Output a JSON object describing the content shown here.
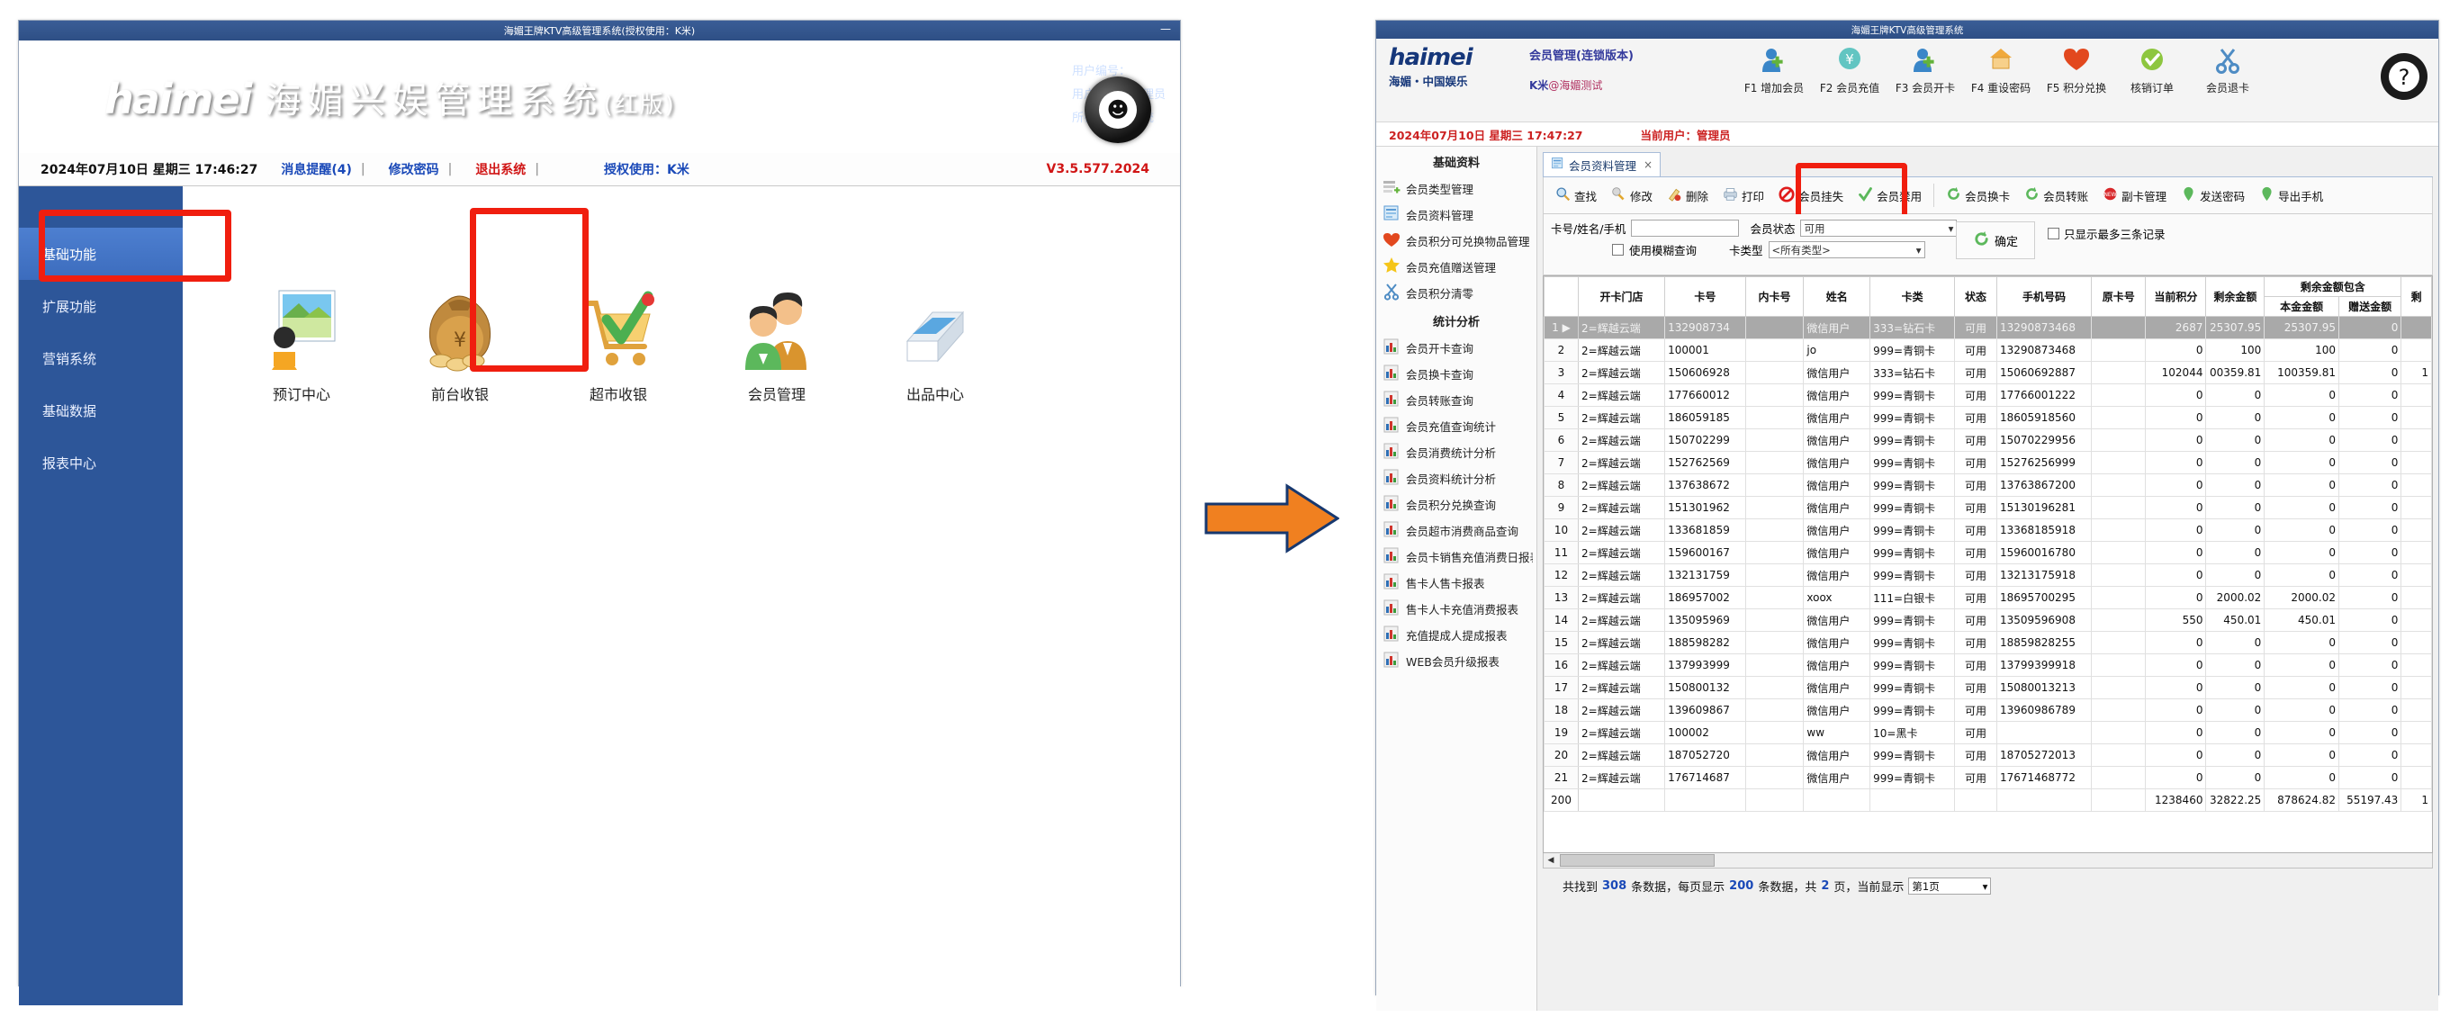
{
  "left_window": {
    "titlebar": {
      "title": "海媚王牌KTV高级管理系统(授权使用：K米)",
      "minimize": "—"
    },
    "banner": {
      "logo_mark": "haimei",
      "logo_title": "海媚兴娱管理系统",
      "logo_title_suffix": "(红版)",
      "user_no_label": "用户编号：",
      "user_name_label": "用户姓名：",
      "user_name_value": "管理员",
      "dept_label": "所在部门：",
      "dept_value": "系统"
    },
    "infobar": {
      "datetime": "2024年07月10日 星期三 17:46:27",
      "msg_link": "消息提醒(4)",
      "pwd_link": "修改密码",
      "exit_link": "退出系统",
      "sep": "|",
      "auth": "授权使用：K米",
      "version": "V3.5.577.2024"
    },
    "sidebar": [
      {
        "label": "基础功能",
        "active": true
      },
      {
        "label": "扩展功能",
        "active": false
      },
      {
        "label": "营销系统",
        "active": false
      },
      {
        "label": "基础数据",
        "active": false
      },
      {
        "label": "报表中心",
        "active": false
      }
    ],
    "apps": [
      {
        "label": "预订中心",
        "icon": "booking-icon"
      },
      {
        "label": "前台收银",
        "icon": "cashier-icon"
      },
      {
        "label": "超市收银",
        "icon": "market-cashier-icon"
      },
      {
        "label": "会员管理",
        "icon": "member-管理-icon",
        "highlighted": true
      },
      {
        "label": "出品中心",
        "icon": "kitchen-icon"
      }
    ],
    "highlight_color": "#f01e0f"
  },
  "arrow": {
    "color": "#f08020",
    "stroke": "#17386f"
  },
  "right_window": {
    "titlebar": {
      "title": "海媚王牌KTV高级管理系统"
    },
    "head": {
      "logo_mark": "haimei",
      "logo_sub": "海媚・中国娱乐",
      "title": "会员管理(连锁版本)",
      "subtitle_prefix": "K米",
      "subtitle": "@海媚测试"
    },
    "toolbar": [
      {
        "label": "F1 增加会员",
        "icon": "add-member-icon"
      },
      {
        "label": "F2 会员充值",
        "icon": "recharge-yen-icon"
      },
      {
        "label": "F3 会员开卡",
        "icon": "open-card-icon"
      },
      {
        "label": "F4 重设密码",
        "icon": "reset-password-icon"
      },
      {
        "label": "F5 积分兑换",
        "icon": "points-exchange-heart-icon"
      },
      {
        "label": "核销订单",
        "icon": "verify-order-check-icon"
      },
      {
        "label": "会员退卡",
        "icon": "return-card-scissors-icon"
      }
    ],
    "help_icon": "help-question-icon",
    "infobar": {
      "datetime": "2024年07月10日 星期三 17:47:27",
      "current_user": "当前用户：管理员"
    },
    "sidebar": {
      "group1_title": "基础资料",
      "group1": [
        {
          "label": "会员类型管理",
          "icon": "list-add-icon"
        },
        {
          "label": "会员资料管理",
          "icon": "document-blue-icon"
        },
        {
          "label": "会员积分可兑换物品管理",
          "icon": "heart-red-icon"
        },
        {
          "label": "会员充值赠送管理",
          "icon": "star-yellow-icon"
        },
        {
          "label": "会员积分清零",
          "icon": "scissors-icon"
        }
      ],
      "group2_title": "统计分析",
      "group2": [
        {
          "label": "会员开卡查询",
          "icon": "report-chart-icon"
        },
        {
          "label": "会员换卡查询",
          "icon": "report-chart-icon"
        },
        {
          "label": "会员转账查询",
          "icon": "report-chart-icon"
        },
        {
          "label": "会员充值查询统计",
          "icon": "report-chart-icon"
        },
        {
          "label": "会员消费统计分析",
          "icon": "report-chart-icon"
        },
        {
          "label": "会员资料统计分析",
          "icon": "report-chart-icon"
        },
        {
          "label": "会员积分兑换查询",
          "icon": "report-chart-icon"
        },
        {
          "label": "会员超市消费商品查询",
          "icon": "report-chart-icon"
        },
        {
          "label": "会员卡销售充值消费日报表",
          "icon": "report-chart-icon"
        },
        {
          "label": "售卡人售卡报表",
          "icon": "report-chart-icon"
        },
        {
          "label": "售卡人卡充值消费报表",
          "icon": "report-chart-icon"
        },
        {
          "label": "充值提成人提成报表",
          "icon": "report-chart-icon"
        },
        {
          "label": "WEB会员升级报表",
          "icon": "report-chart-icon"
        }
      ]
    },
    "tab": {
      "label": "会员资料管理",
      "close": "×",
      "icon": "document-blue-icon"
    },
    "actions": [
      {
        "label": "查找",
        "icon": "magnifier-icon",
        "highlighted": false
      },
      {
        "label": "修改",
        "icon": "pencil-edit-icon",
        "highlighted": false
      },
      {
        "label": "删除",
        "icon": "pencil-delete-icon",
        "highlighted": false
      },
      {
        "label": "打印",
        "icon": "printer-icon",
        "highlighted": false
      },
      {
        "label": "会员挂失",
        "icon": "forbidden-icon",
        "highlighted": true
      },
      {
        "label": "会员禁用",
        "icon": "check-green-icon",
        "highlighted": false
      },
      {
        "label": "会员换卡",
        "icon": "refresh-green-icon",
        "highlighted": false
      },
      {
        "label": "会员转账",
        "icon": "refresh-green-icon",
        "highlighted": false
      },
      {
        "label": "副卡管理",
        "icon": "new-badge-icon",
        "highlighted": false
      },
      {
        "label": "发送密码",
        "icon": "pin-green-icon",
        "highlighted": false
      },
      {
        "label": "导出手机",
        "icon": "pin-green-icon",
        "highlighted": false
      }
    ],
    "filter": {
      "keyword_label": "卡号/姓名/手机",
      "keyword_value": "",
      "status_label": "会员状态",
      "status_value": "可用",
      "fuzzy_label": "使用模糊查询",
      "fuzzy_checked": false,
      "cardtype_label": "卡类型",
      "cardtype_value": "<所有类型>",
      "ok_label": "确定",
      "ok_icon": "refresh-green-icon",
      "only3_label": "只显示最多三条记录",
      "only3_checked": false
    },
    "table": {
      "group_header": "剩余金额包含",
      "columns": [
        "开卡门店",
        "卡号",
        "内卡号",
        "姓名",
        "卡类",
        "状态",
        "手机号码",
        "原卡号",
        "当前积分",
        "剩余金额",
        "本金金额",
        "赠送金额",
        "剩"
      ],
      "rows": [
        {
          "idx": "1",
          "marker": "▶",
          "selected": true,
          "cells": [
            "2=辉越云端",
            "132908734",
            "",
            "微信用户",
            "333=钻石卡",
            "可用",
            "13290873468",
            "",
            "2687",
            "25307.95",
            "25307.95",
            "0",
            ""
          ]
        },
        {
          "idx": "2",
          "marker": "",
          "selected": false,
          "cells": [
            "2=辉越云端",
            "100001",
            "",
            "jo",
            "999=青铜卡",
            "可用",
            "13290873468",
            "",
            "0",
            "100",
            "100",
            "0",
            ""
          ]
        },
        {
          "idx": "3",
          "marker": "",
          "selected": false,
          "cells": [
            "2=辉越云端",
            "150606928",
            "",
            "微信用户",
            "333=钻石卡",
            "可用",
            "15060692887",
            "",
            "102044",
            "00359.81",
            "100359.81",
            "0",
            "1"
          ]
        },
        {
          "idx": "4",
          "marker": "",
          "selected": false,
          "cells": [
            "2=辉越云端",
            "177660012",
            "",
            "微信用户",
            "999=青铜卡",
            "可用",
            "17766001222",
            "",
            "0",
            "0",
            "0",
            "0",
            ""
          ]
        },
        {
          "idx": "5",
          "marker": "",
          "selected": false,
          "cells": [
            "2=辉越云端",
            "186059185",
            "",
            "微信用户",
            "999=青铜卡",
            "可用",
            "18605918560",
            "",
            "0",
            "0",
            "0",
            "0",
            ""
          ]
        },
        {
          "idx": "6",
          "marker": "",
          "selected": false,
          "cells": [
            "2=辉越云端",
            "150702299",
            "",
            "微信用户",
            "999=青铜卡",
            "可用",
            "15070229956",
            "",
            "0",
            "0",
            "0",
            "0",
            ""
          ]
        },
        {
          "idx": "7",
          "marker": "",
          "selected": false,
          "cells": [
            "2=辉越云端",
            "152762569",
            "",
            "微信用户",
            "999=青铜卡",
            "可用",
            "15276256999",
            "",
            "0",
            "0",
            "0",
            "0",
            ""
          ]
        },
        {
          "idx": "8",
          "marker": "",
          "selected": false,
          "cells": [
            "2=辉越云端",
            "137638672",
            "",
            "微信用户",
            "999=青铜卡",
            "可用",
            "13763867200",
            "",
            "0",
            "0",
            "0",
            "0",
            ""
          ]
        },
        {
          "idx": "9",
          "marker": "",
          "selected": false,
          "cells": [
            "2=辉越云端",
            "151301962",
            "",
            "微信用户",
            "999=青铜卡",
            "可用",
            "15130196281",
            "",
            "0",
            "0",
            "0",
            "0",
            ""
          ]
        },
        {
          "idx": "10",
          "marker": "",
          "selected": false,
          "cells": [
            "2=辉越云端",
            "133681859",
            "",
            "微信用户",
            "999=青铜卡",
            "可用",
            "13368185918",
            "",
            "0",
            "0",
            "0",
            "0",
            ""
          ]
        },
        {
          "idx": "11",
          "marker": "",
          "selected": false,
          "cells": [
            "2=辉越云端",
            "159600167",
            "",
            "微信用户",
            "999=青铜卡",
            "可用",
            "15960016780",
            "",
            "0",
            "0",
            "0",
            "0",
            ""
          ]
        },
        {
          "idx": "12",
          "marker": "",
          "selected": false,
          "cells": [
            "2=辉越云端",
            "132131759",
            "",
            "微信用户",
            "999=青铜卡",
            "可用",
            "13213175918",
            "",
            "0",
            "0",
            "0",
            "0",
            ""
          ]
        },
        {
          "idx": "13",
          "marker": "",
          "selected": false,
          "cells": [
            "2=辉越云端",
            "186957002",
            "",
            "xoox",
            "111=白银卡",
            "可用",
            "18695700295",
            "",
            "0",
            "2000.02",
            "2000.02",
            "0",
            ""
          ]
        },
        {
          "idx": "14",
          "marker": "",
          "selected": false,
          "cells": [
            "2=辉越云端",
            "135095969",
            "",
            "微信用户",
            "999=青铜卡",
            "可用",
            "13509596908",
            "",
            "550",
            "450.01",
            "450.01",
            "0",
            ""
          ]
        },
        {
          "idx": "15",
          "marker": "",
          "selected": false,
          "cells": [
            "2=辉越云端",
            "188598282",
            "",
            "微信用户",
            "999=青铜卡",
            "可用",
            "18859828255",
            "",
            "0",
            "0",
            "0",
            "0",
            ""
          ]
        },
        {
          "idx": "16",
          "marker": "",
          "selected": false,
          "cells": [
            "2=辉越云端",
            "137993999",
            "",
            "微信用户",
            "999=青铜卡",
            "可用",
            "13799399918",
            "",
            "0",
            "0",
            "0",
            "0",
            ""
          ]
        },
        {
          "idx": "17",
          "marker": "",
          "selected": false,
          "cells": [
            "2=辉越云端",
            "150800132",
            "",
            "微信用户",
            "999=青铜卡",
            "可用",
            "15080013213",
            "",
            "0",
            "0",
            "0",
            "0",
            ""
          ]
        },
        {
          "idx": "18",
          "marker": "",
          "selected": false,
          "cells": [
            "2=辉越云端",
            "139609867",
            "",
            "微信用户",
            "999=青铜卡",
            "可用",
            "13960986789",
            "",
            "0",
            "0",
            "0",
            "0",
            ""
          ]
        },
        {
          "idx": "19",
          "marker": "",
          "selected": false,
          "cells": [
            "2=辉越云端",
            "100002",
            "",
            "ww",
            "10=黑卡",
            "可用",
            "",
            "",
            "0",
            "0",
            "0",
            "0",
            ""
          ]
        },
        {
          "idx": "20",
          "marker": "",
          "selected": false,
          "cells": [
            "2=辉越云端",
            "187052720",
            "",
            "微信用户",
            "999=青铜卡",
            "可用",
            "18705272013",
            "",
            "0",
            "0",
            "0",
            "0",
            ""
          ]
        },
        {
          "idx": "21",
          "marker": "",
          "selected": false,
          "cells": [
            "2=辉越云端",
            "176714687",
            "",
            "微信用户",
            "999=青铜卡",
            "可用",
            "17671468772",
            "",
            "0",
            "0",
            "0",
            "0",
            ""
          ]
        }
      ],
      "summary": {
        "idx": "200",
        "points": "1238460",
        "remain": "32822.25",
        "principal": "878624.82",
        "gift": "55197.43",
        "last": "1"
      }
    },
    "status": {
      "prefix": "共找到",
      "total": "308",
      "mid1": "条数据，每页显示",
      "page_size": "200",
      "mid2": "条数据，共",
      "pages": "2",
      "mid3": "页，当前显示",
      "current_page": "第1页"
    }
  }
}
